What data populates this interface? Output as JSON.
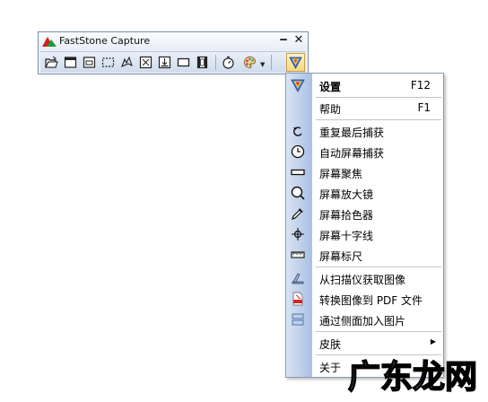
{
  "window": {
    "title": "FastStone Capture",
    "minimize_glyph": "▁",
    "close_glyph": "✕"
  },
  "toolbar": {
    "tools": [
      {
        "name": "open-file-icon"
      },
      {
        "name": "capture-active-window-icon"
      },
      {
        "name": "capture-window-object-icon"
      },
      {
        "name": "capture-rectangular-region-icon"
      },
      {
        "name": "capture-freehand-region-icon"
      },
      {
        "name": "capture-full-screen-icon"
      },
      {
        "name": "capture-scrolling-window-icon"
      },
      {
        "name": "capture-fixed-region-icon"
      },
      {
        "name": "screen-recorder-icon"
      },
      {
        "name": "delay-timer-icon"
      },
      {
        "name": "output-palette-icon"
      },
      {
        "name": "settings-menu-icon"
      }
    ]
  },
  "menu": {
    "items": [
      {
        "label": "设置",
        "shortcut": "F12",
        "icon": "settings-logo-icon"
      },
      {
        "label": "帮助",
        "shortcut": "F1"
      },
      {
        "label": "重复最后捕获",
        "icon": "repeat-arrow-icon"
      },
      {
        "label": "自动屏幕捕获",
        "icon": "clock-icon"
      },
      {
        "label": "屏幕聚焦",
        "icon": "spotlight-bar-icon"
      },
      {
        "label": "屏幕放大镜",
        "icon": "magnifier-icon"
      },
      {
        "label": "屏幕拾色器",
        "icon": "eyedropper-icon"
      },
      {
        "label": "屏幕十字线",
        "icon": "crosshair-icon"
      },
      {
        "label": "屏幕标尺",
        "icon": "ruler-icon"
      },
      {
        "label": "从扫描仪获取图像",
        "icon": "scanner-icon"
      },
      {
        "label": "转换图像到 PDF 文件",
        "icon": "pdf-icon"
      },
      {
        "label": "通过侧面加入图片",
        "icon": "join-images-icon"
      },
      {
        "label": "皮肤",
        "submenu_arrow": "▶"
      },
      {
        "label": "关于"
      }
    ]
  },
  "watermark": {
    "text": "广东龙网"
  },
  "colors": {
    "menu_gutter": "#a9c0e2",
    "toolbar_bg": "#d0dcec",
    "watermark_outline": "#000000"
  }
}
